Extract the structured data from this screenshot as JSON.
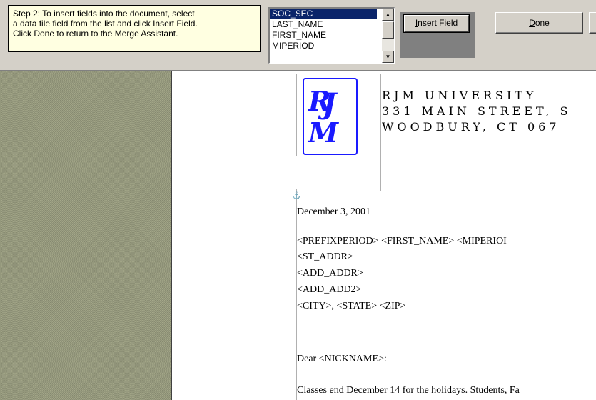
{
  "toolbar": {
    "instructions": [
      "Step 2: To insert fields into the document, select",
      "a data file field from the list and click Insert Field.",
      "Click Done to return to the Merge Assistant."
    ],
    "field_list": [
      "SOC_SEC",
      "LAST_NAME",
      "FIRST_NAME",
      "MIPERIOD"
    ],
    "selected_field": "SOC_SEC",
    "insert_label_pre": "",
    "insert_label_ul": "I",
    "insert_label_post": "nsert Field",
    "done_label_ul": "D",
    "done_label_post": "one"
  },
  "document": {
    "letterhead": [
      "RJM  UNIVERSITY",
      "331  MAIN  STREET,  S",
      "WOODBURY,  CT  067"
    ],
    "date": "December 3, 2001",
    "address_lines": [
      " <PREFIXPERIOD> <FIRST_NAME> <MIPERIOI",
      "<ST_ADDR>",
      "<ADD_ADDR>",
      "<ADD_ADD2>",
      "<CITY>, <STATE>  <ZIP>"
    ],
    "salutation": "Dear <NICKNAME>:",
    "body_line": "Classes end December 14 for the holidays.  Students, Fa"
  },
  "colors": {
    "logo_blue": "#1a1aff",
    "tooltip_bg": "#ffffe1",
    "selection": "#0a246a"
  },
  "icons": {
    "logo": "rjm-logo",
    "anchor": "anchor-icon"
  }
}
